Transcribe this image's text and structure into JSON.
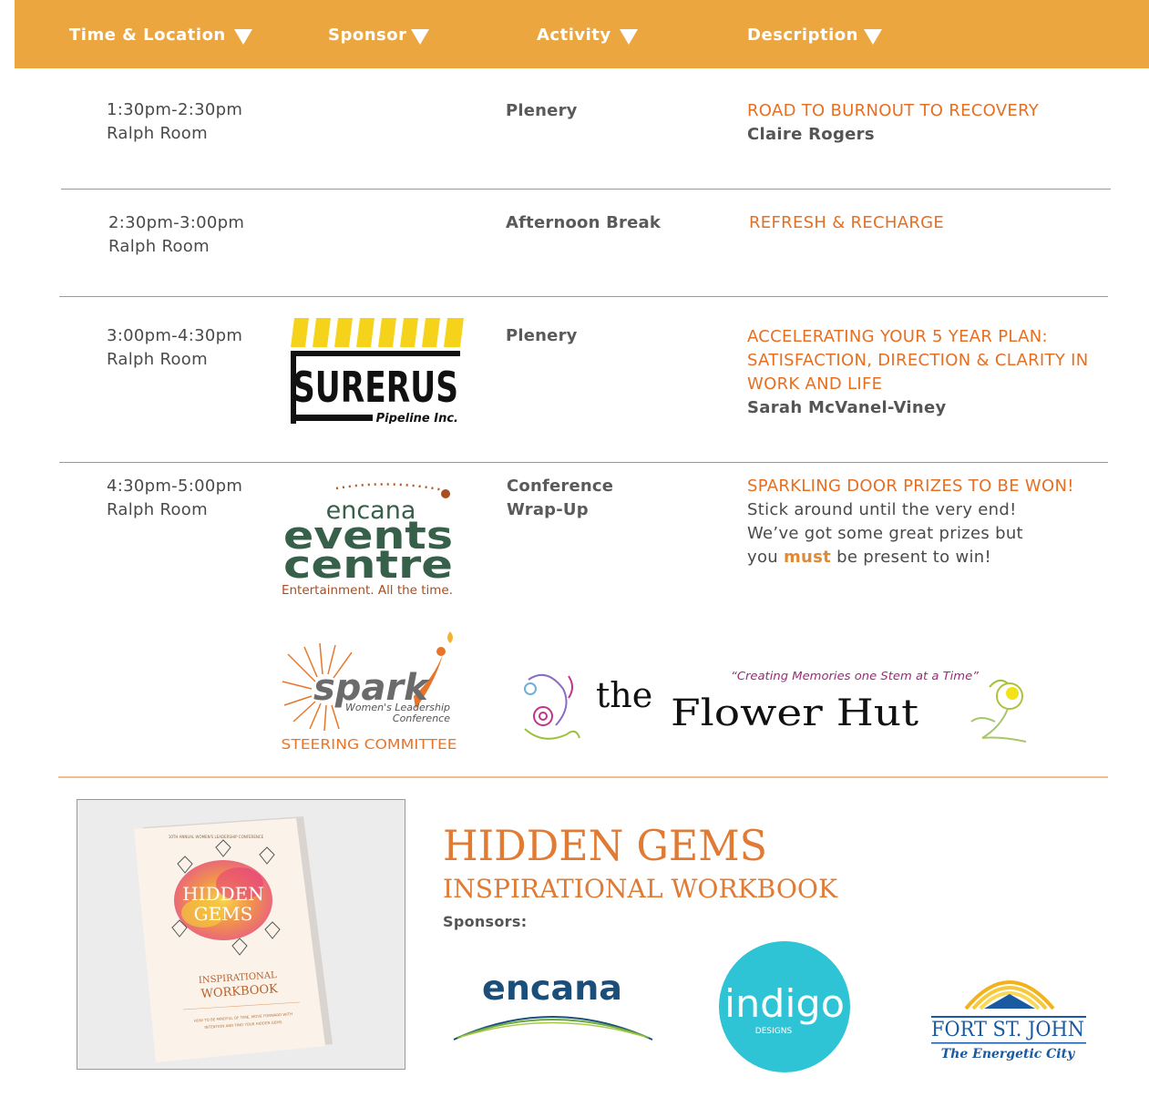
{
  "header": {
    "columns": [
      {
        "label": "Time & Location"
      },
      {
        "label": "Sponsor"
      },
      {
        "label": "Activity"
      },
      {
        "label": "Description"
      }
    ]
  },
  "rows": [
    {
      "time": "1:30pm-2:30pm",
      "location": "Ralph Room",
      "activity": "Plenery",
      "title": "ROAD TO BURNOUT TO RECOVERY",
      "speaker": "Claire Rogers"
    },
    {
      "time": "2:30pm-3:00pm",
      "location": "Ralph Room",
      "activity": "Afternoon Break",
      "title": "REFRESH & RECHARGE"
    },
    {
      "time": "3:00pm-4:30pm",
      "location": "Ralph Room",
      "sponsor_logo": {
        "main": "SURERUS",
        "sub": "Pipeline Inc."
      },
      "activity": "Plenery",
      "title_lines": [
        "ACCELERATING YOUR 5 YEAR PLAN:",
        "SATISFACTION, DIRECTION & CLARITY IN",
        "WORK AND LIFE"
      ],
      "speaker": "Sarah McVanel-Viney"
    },
    {
      "time": "4:30pm-5:00pm",
      "location": "Ralph Room",
      "sponsor_logo": {
        "top": "encana",
        "line1": "events",
        "line2": "centre",
        "tagline": "Entertainment. All the time."
      },
      "activity_lines": [
        "Conference",
        "Wrap-Up"
      ],
      "title": "SPARKLING DOOR PRIZES TO BE WON!",
      "desc_lines": [
        "Stick around until the very end!",
        "We’ve got some great prizes but"
      ],
      "desc_last": {
        "before": "you ",
        "emph": "must",
        "after": " be present to win!"
      }
    }
  ],
  "sponsors_extra": {
    "spark": {
      "word": "spark",
      "sub1": "Women's Leadership",
      "sub2": "Conference",
      "caption": "STEERING COMMITTEE"
    },
    "flower_hut": {
      "tagline": "“Creating Memories one Stem at a Time”",
      "name_the": "the",
      "name_main": "Flower Hut"
    }
  },
  "workbook": {
    "cover": {
      "top": "10TH ANNUAL WOMEN'S LEADERSHIP CONFERENCE",
      "title1": "HIDDEN",
      "title2": "GEMS",
      "sub1": "INSPIRATIONAL",
      "sub2": "WORKBOOK",
      "small1": "HOW TO BE MINDFUL OF TIME, MOVE FORWARD WITH",
      "small2": "INTENTION AND FIND YOUR HIDDEN GEMS"
    },
    "title": "HIDDEN GEMS",
    "subtitle": "INSPIRATIONAL WORKBOOK",
    "sponsors_label": "Sponsors:",
    "sponsors": [
      {
        "name": "encana"
      },
      {
        "name": "indigo",
        "sub": "DESIGNS"
      },
      {
        "name": "FORT ST. JOHN",
        "tagline": "The Energetic City"
      }
    ]
  },
  "colors": {
    "header": "#eca63f",
    "accent_orange": "#e56f22",
    "text": "#4a4a4a"
  }
}
